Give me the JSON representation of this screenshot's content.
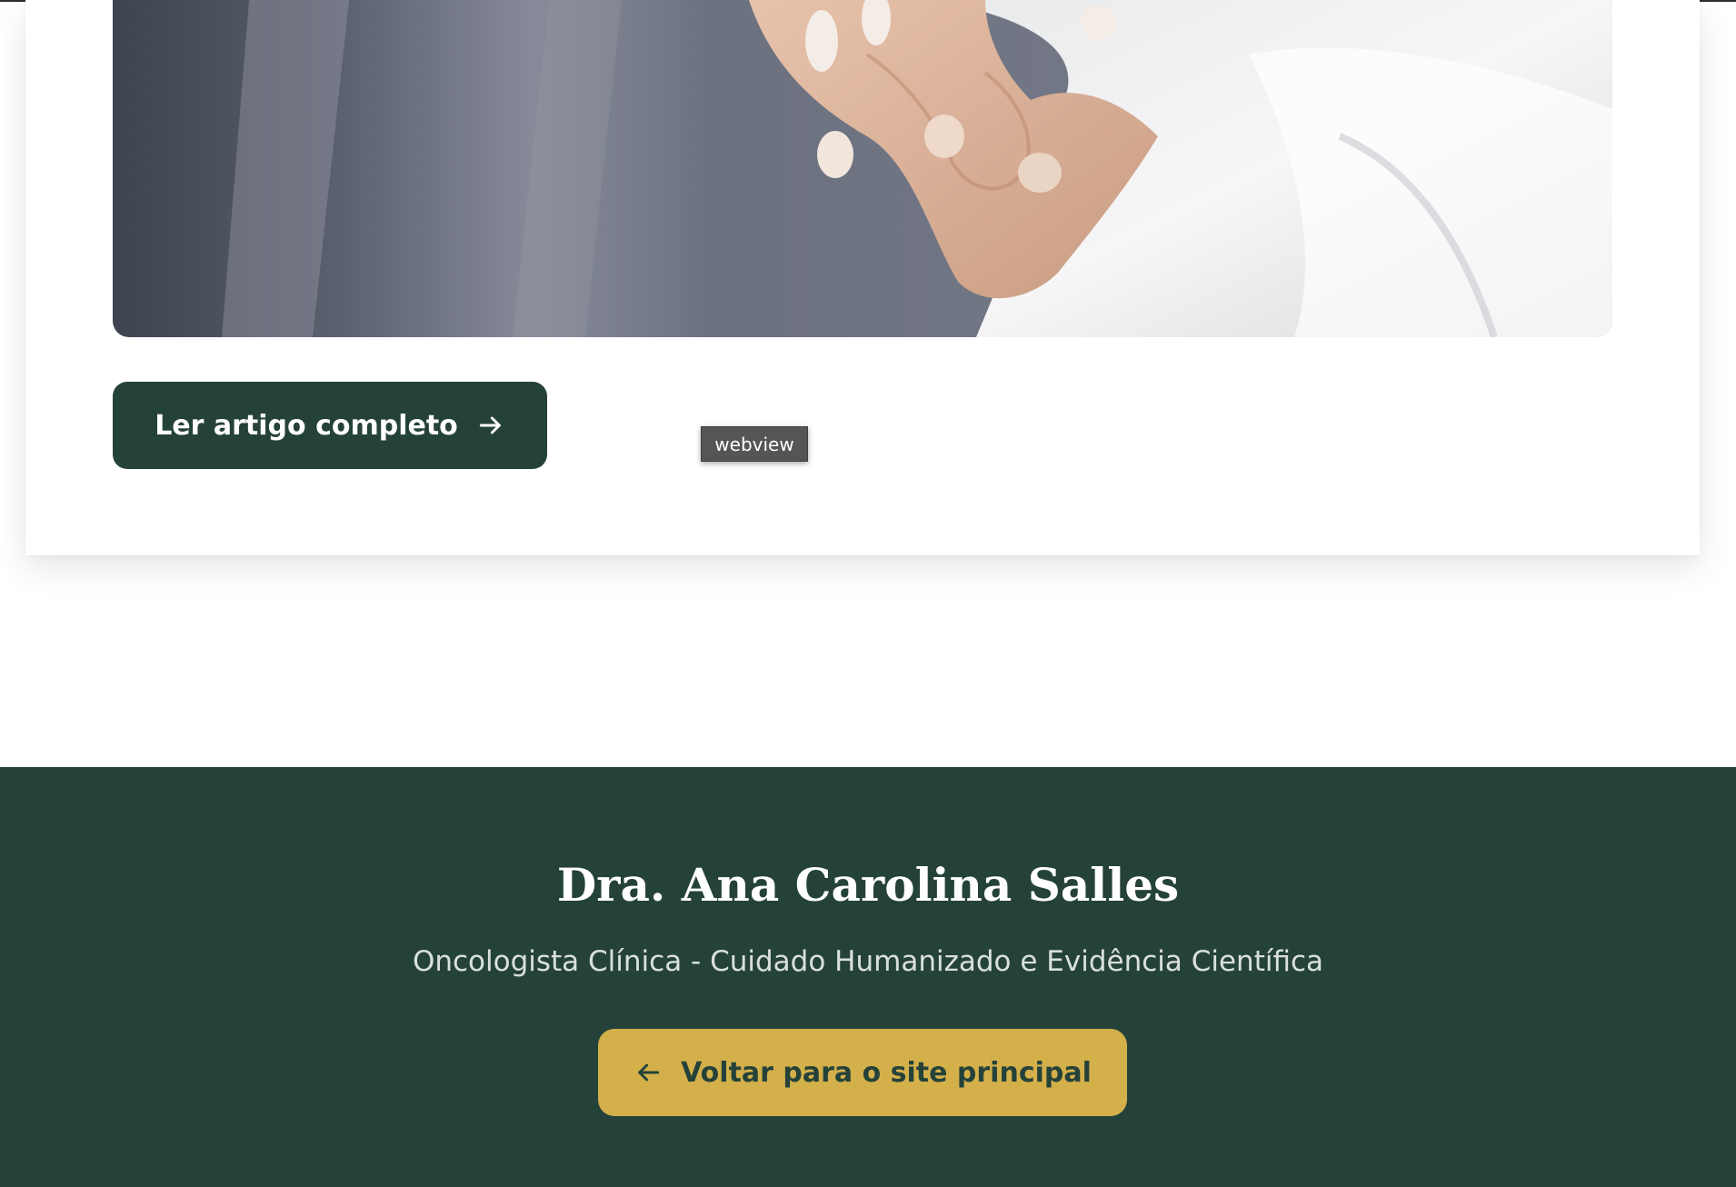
{
  "article": {
    "image_alt": "Mãos entrelaçadas entre médica e paciente",
    "read_more_label": "Ler artigo completo",
    "read_more_icon": "arrow-right-icon"
  },
  "tooltip": {
    "text": "webview"
  },
  "footer": {
    "title": "Dra. Ana Carolina Salles",
    "subtitle": "Oncologista Clínica - Cuidado Humanizado e Evidência Científica",
    "back_label": "Voltar para o site principal",
    "back_icon": "arrow-left-icon"
  },
  "colors": {
    "brand_green": "#25423a",
    "accent_gold": "#d4b04a",
    "white": "#ffffff"
  }
}
